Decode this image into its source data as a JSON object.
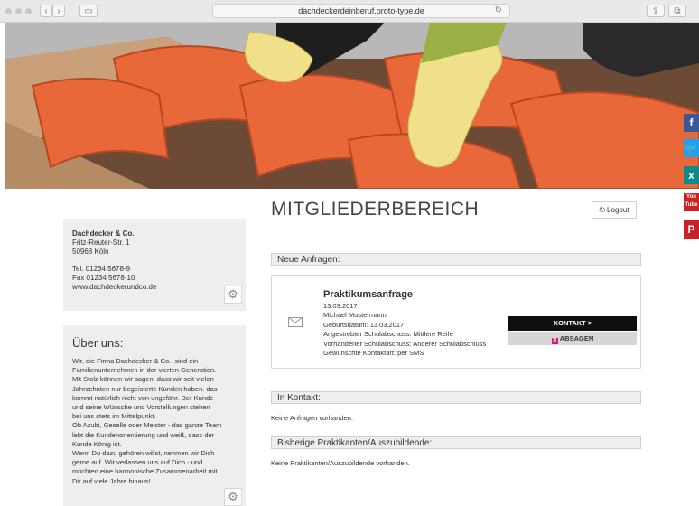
{
  "browser": {
    "url": "dachdeckerdeinberuf.proto-type.de",
    "back_icon": "chevron-left",
    "forward_icon": "chevron-right",
    "reload_icon": "reload"
  },
  "social": [
    "f",
    "t",
    "x",
    "You Tube",
    "P"
  ],
  "company": {
    "name": "Dachdecker & Co.",
    "street": "Fritz-Reuter-Str. 1",
    "city": "50968 Köln",
    "tel": "Tel. 01234 5678-9",
    "fax": "Fax 01234 5678-10",
    "web": "www.dachdeckerundco.de"
  },
  "about": {
    "title": "Über uns:",
    "text": "Wir, die Firma Dachdecker & Co., sind ein\nFamilienunternehmen in der vierten Generation.\nMit Stolz können wir sagen, dass wir seit vielen\nJahrzehnten nur begeisterte Kunden haben. das\nkommt natürlich nicht von ungefähr. Der Kunde\nund seine Wünsche und Vorstellungen stehen\nbei uns stets im Mittelpunkt.\nOb Azubi, Geselle oder Meister - das ganze Team\nlebt die Kundenorientierung und weiß, dass der\nKunde König ist.\nWenn Du dazu gehören willst, nehmen wir Dich\ngerne auf. Wir verlassen uns auf Dich - und\nmöchten eine harmonische Zusammenarbeit mit\nDir auf viele Jahre hinaus!"
  },
  "main": {
    "title": "MITGLIEDERBEREICH",
    "logout_label": "Logout",
    "sections": {
      "new": "Neue Anfragen:",
      "contact": "In Kontakt:",
      "past": "Bisherige Praktikanten/Auszubildende:"
    },
    "request": {
      "title": "Praktikumsanfrage",
      "date": "13.03.2017",
      "name": "Michael Mustermann",
      "birth": "Geburtsdatum: 13.03.2017",
      "school_target": "Angestrebter Schulabschuss: Mittlere Reife",
      "school_current": "Vorhandener Schulabschuss: Anderer Schulabschluss",
      "contact_type": "Gewünschte Kontaktart: per SMS",
      "contact_btn": "KONTAKT >",
      "decline_btn": "ABSAGEN"
    },
    "contact_empty": "Keine Anfragen vorhanden.",
    "past_empty": "Keine Praktikanten/Auszubildende vorhanden."
  }
}
